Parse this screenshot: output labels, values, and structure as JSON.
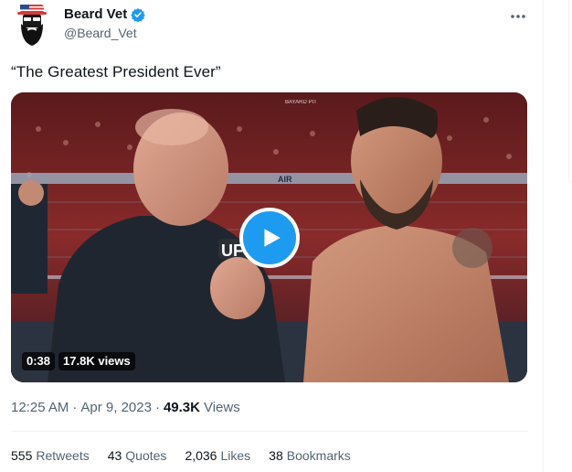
{
  "tweet": {
    "display_name": "Beard Vet",
    "handle": "@Beard_Vet",
    "text": "“The Greatest President Ever”",
    "time": "12:25 AM",
    "separator": "·",
    "date": "Apr 9, 2023",
    "views_count": "49.3K",
    "views_label": "Views"
  },
  "video": {
    "duration": "0:38",
    "views": "17.8K views",
    "overlay_text": {
      "logo_left": "UFC",
      "ring_sign": "AIR",
      "top_sign": "BAYARD PIT"
    }
  },
  "stats": [
    {
      "count": "555",
      "label": "Retweets"
    },
    {
      "count": "43",
      "label": "Quotes"
    },
    {
      "count": "2,036",
      "label": "Likes"
    },
    {
      "count": "38",
      "label": "Bookmarks"
    }
  ],
  "colors": {
    "accent": "#1d9bf0",
    "secondary_text": "#536471",
    "primary_text": "#0f1419",
    "divider": "#eff3f4"
  },
  "icons": {
    "verified": "verified-badge-icon",
    "more": "more-options-icon",
    "play": "play-icon",
    "avatar": "beard-avatar-icon"
  }
}
